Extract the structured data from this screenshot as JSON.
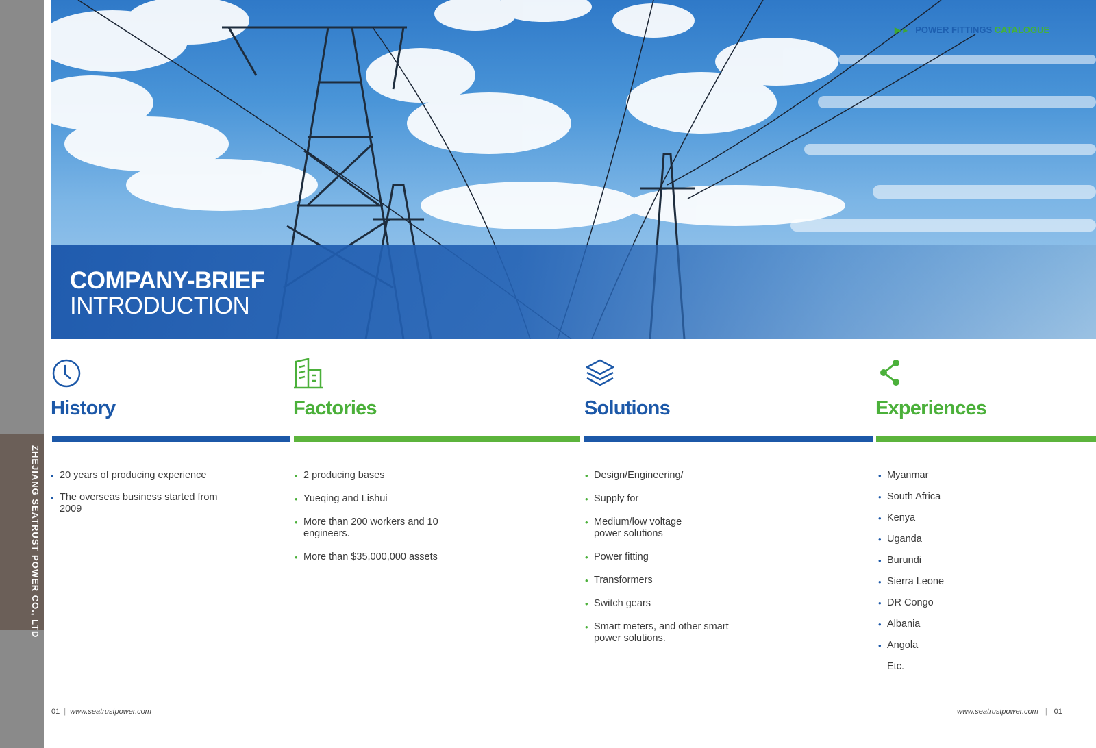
{
  "spine": {
    "text": "ZHEJIANG SEATRUST POWER CO., LTD"
  },
  "header": {
    "catalogue_part1": "POWER FITTINGS",
    "catalogue_part2": "CATALOGUE"
  },
  "hero": {
    "title_bold": "COMPANY-BRIEF",
    "title_regular": "INTRODUCTION"
  },
  "columns": [
    {
      "title": "History",
      "icon": "clock-icon",
      "color": "#1c58a8",
      "items": [
        "20 years of producing experience",
        "The overseas business started from 2009"
      ]
    },
    {
      "title": "Factories",
      "icon": "building-icon",
      "color": "#4bb03a",
      "items": [
        "2 producing bases",
        "Yueqing and Lishui",
        "More than 200 workers and 10 engineers.",
        "More than $35,000,000 assets"
      ]
    },
    {
      "title": "Solutions",
      "icon": "layers-icon",
      "color": "#1c58a8",
      "items": [
        "Design/Engineering/",
        "Supply for",
        "Medium/low voltage power solutions",
        "Power fitting",
        "Transformers",
        "Switch gears",
        "Smart meters, and other smart power solutions."
      ]
    },
    {
      "title": "Experiences",
      "icon": "share-icon",
      "color": "#4bb03a",
      "items": [
        "Myanmar",
        "South Africa",
        "Kenya",
        "Uganda",
        "Burundi",
        "Sierra Leone",
        "DR Congo",
        "Albania",
        "Angola"
      ],
      "extra": "Etc."
    }
  ],
  "footer": {
    "left_page": "01",
    "left_url": "www.seatrustpower.com",
    "right_url": "www.seatrustpower.com",
    "right_page": "01"
  }
}
